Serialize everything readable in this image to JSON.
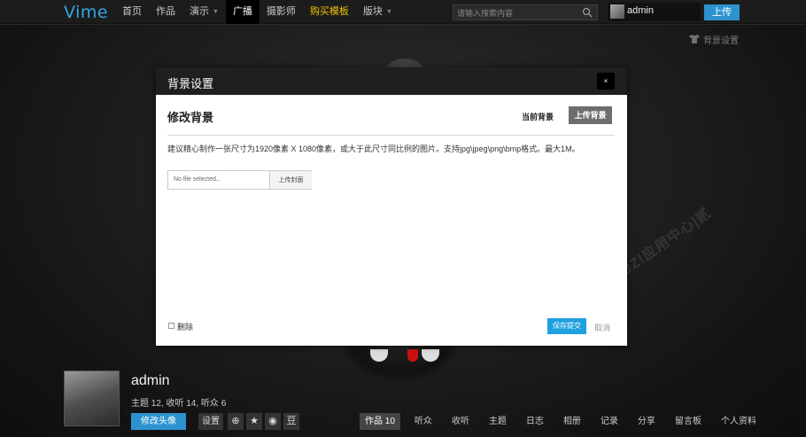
{
  "header": {
    "logo": "Vime",
    "nav": [
      {
        "label": "首页",
        "name": "nav-home"
      },
      {
        "label": "作品",
        "name": "nav-works"
      },
      {
        "label": "演示",
        "name": "nav-demo",
        "caret": true
      },
      {
        "label": "广播",
        "name": "nav-broadcast",
        "active": true
      },
      {
        "label": "摄影师",
        "name": "nav-photographers"
      },
      {
        "label": "购买模板",
        "name": "nav-buy-template",
        "hot": true
      },
      {
        "label": "版块",
        "name": "nav-forums",
        "caret": true
      }
    ],
    "search_placeholder": "请输入搜索内容",
    "user_name": "admin",
    "upload_label": "上传"
  },
  "background_setting_label": "背景设置",
  "profile": {
    "name": "admin",
    "stats": "主题 12,  收听 14,  听众 6",
    "edit_avatar_label": "修改头像",
    "settings_label": "设置",
    "share_icons": [
      {
        "icon": "weibo-icon",
        "glyph": "⊕"
      },
      {
        "icon": "star-icon",
        "glyph": "★"
      },
      {
        "icon": "renren-icon",
        "glyph": "◉"
      },
      {
        "icon": "douban-icon",
        "glyph": "豆"
      }
    ],
    "tabs": [
      {
        "label": "作品 10",
        "active": true
      },
      {
        "label": "听众"
      },
      {
        "label": "收听"
      },
      {
        "label": "主题"
      },
      {
        "label": "日志"
      },
      {
        "label": "相册"
      },
      {
        "label": "记录"
      },
      {
        "label": "分享"
      },
      {
        "label": "留言板"
      },
      {
        "label": "个人资料"
      }
    ]
  },
  "modal": {
    "title": "背景设置",
    "close_glyph": "×",
    "heading": "修改背景",
    "tab_current": "当前背景",
    "tab_upload": "上传背景",
    "description": "建议精心制作一张尺寸为1920像素 X 1080像素，或大于此尺寸同比例的图片。支持jpg\\jpeg\\png\\bmp格式。最大1M。",
    "file_text": "No file selected...",
    "file_button": "上传封面",
    "delete_label": "删除",
    "save_label": "保存提交",
    "cancel_label": "取消"
  },
  "watermark": "DISCUZ!应用中心|贰",
  "colors": {
    "accent": "#2d93cf",
    "save": "#1fa0e0",
    "hot_nav": "#f0c000",
    "logo": "#33a6e6"
  }
}
